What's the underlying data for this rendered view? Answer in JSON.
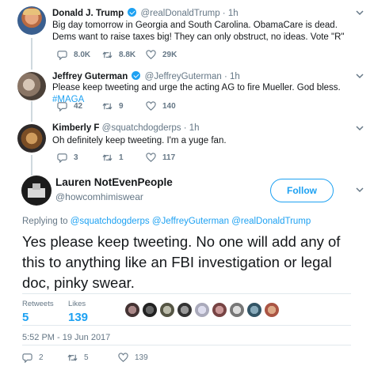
{
  "tweets": [
    {
      "name": "Donald J. Trump",
      "handle": "@realDonaldTrump",
      "time": "· 1h",
      "text": "Big day tomorrow in Georgia and South Carolina. ObamaCare is dead. Dems want to raise taxes big! They can only obstruct, no ideas. Vote \"R\"",
      "replies": "8.0K",
      "retweets": "8.8K",
      "likes": "29K"
    },
    {
      "name": "Jeffrey Guterman",
      "handle": "@JeffreyGuterman",
      "time": "· 1h",
      "text": "Please keep tweeting and urge the acting AG to fire Mueller. God bless.",
      "hashtag": "#MAGA",
      "replies": "42",
      "retweets": "9",
      "likes": "140"
    },
    {
      "name": "Kimberly F",
      "handle": "@squatchdogderps",
      "time": "· 1h",
      "text": "Oh definitely keep tweeting. I'm a yuge fan.",
      "replies": "3",
      "retweets": "1",
      "likes": "117"
    }
  ],
  "main": {
    "name": "Lauren NotEvenPeople",
    "handle": "@howcomhimiswear",
    "follow_label": "Follow",
    "replying_prefix": "Replying to",
    "mentions": [
      "@squatchdogderps",
      "@JeffreyGuterman",
      "@realDonaldTrump"
    ],
    "text": "Yes please keep tweeting. No one will add any of this to anything like an FBI investigation or legal doc, pinky swear.",
    "retweets_label": "Retweets",
    "retweets_count": "5",
    "likes_label": "Likes",
    "likes_count": "139",
    "timestamp": "5:52 PM - 19 Jun 2017",
    "replies": "2",
    "retweets": "5",
    "likes": "139"
  },
  "colors": {
    "accent": "#1da1f2",
    "secondary_text": "#657786",
    "primary_text": "#14171a",
    "border": "#e1e8ed"
  },
  "icons": [
    "reply-icon",
    "retweet-icon",
    "heart-icon",
    "chevron-down-icon",
    "verified-badge-icon"
  ]
}
